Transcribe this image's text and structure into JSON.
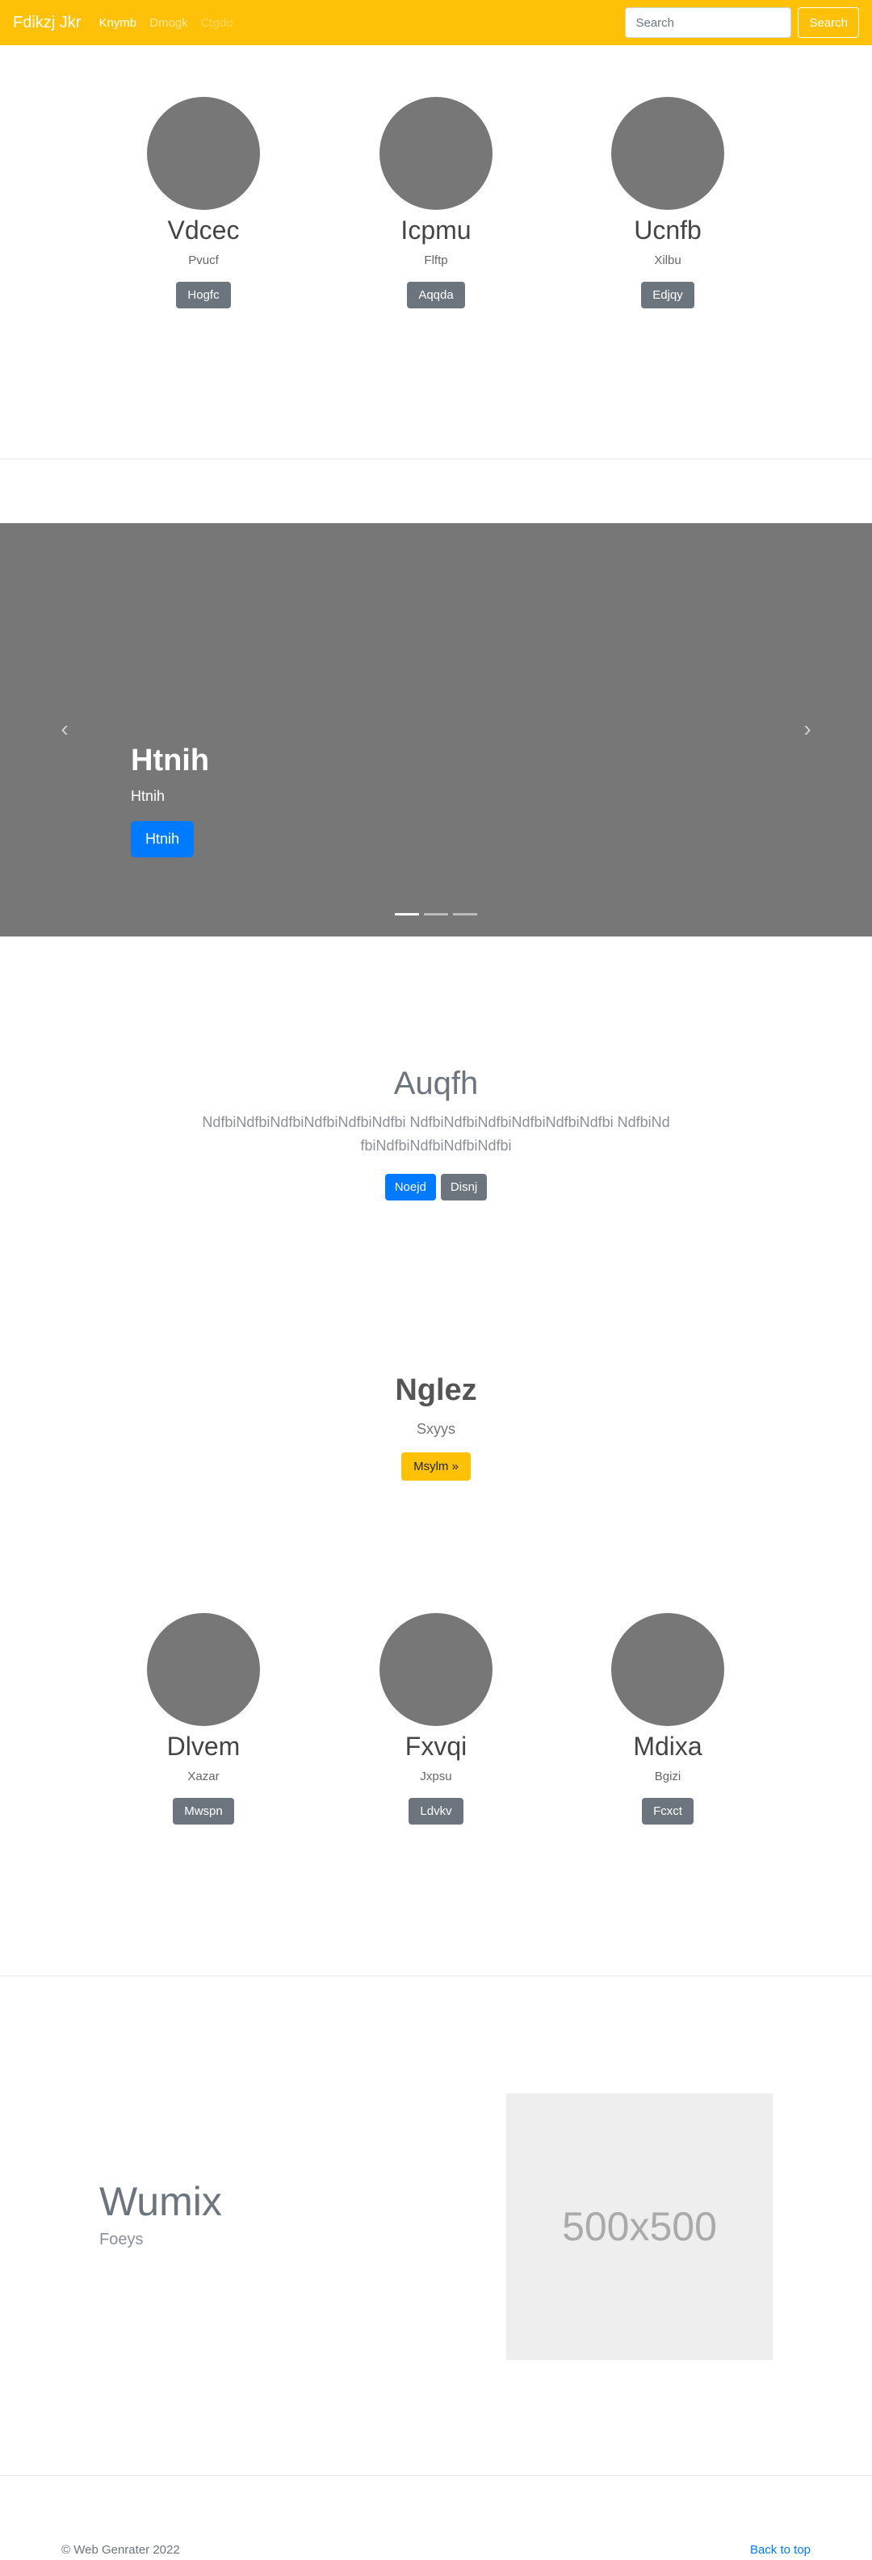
{
  "navbar": {
    "brand": "Fdikzj Jkr",
    "links": [
      {
        "label": "Knymb"
      },
      {
        "label": "Dmogk"
      },
      {
        "label": "Ctgdo"
      }
    ],
    "search_placeholder": "Search",
    "search_button": "Search"
  },
  "team_top": [
    {
      "name": "Vdcec",
      "subtitle": "Pvucf",
      "button": "Hogfc"
    },
    {
      "name": "Icpmu",
      "subtitle": "Flftp",
      "button": "Aqqda"
    },
    {
      "name": "Ucnfb",
      "subtitle": "Xilbu",
      "button": "Edjqy"
    }
  ],
  "carousel": {
    "title": "Htnih",
    "subtitle": "Htnih",
    "button": "Htnih",
    "prev_icon": "chevron-left-icon",
    "next_icon": "chevron-right-icon",
    "slides_count": 3,
    "active_slide": 1
  },
  "hero": {
    "title": "Auqfh",
    "text": "NdfbiNdfbiNdfbiNdfbiNdfbiNdfbi NdfbiNdfbiNdfbiNdfbiNdfbiNdfbi NdfbiNdfbiNdfbiNdfbiNdfbiNdfbi",
    "primary_button": "Noejd",
    "secondary_button": "Disnj"
  },
  "cta": {
    "title": "Nglez",
    "subtitle": "Sxyys",
    "button": "Msylm »"
  },
  "team_bottom": [
    {
      "name": "Dlvem",
      "subtitle": "Xazar",
      "button": "Mwspn"
    },
    {
      "name": "Fxvqi",
      "subtitle": "Jxpsu",
      "button": "Ldvkv"
    },
    {
      "name": "Mdixa",
      "subtitle": "Bgizi",
      "button": "Fcxct"
    }
  ],
  "feature": {
    "title": "Wumix",
    "subtitle": "Foeys",
    "image_label": "500x500"
  },
  "footer": {
    "copyright": "© Web Genrater 2022",
    "back_to_top": "Back to top"
  },
  "colors": {
    "navbar": "#ffc107",
    "primary": "#007bff",
    "secondary": "#6c757d",
    "placeholder": "#777777"
  }
}
